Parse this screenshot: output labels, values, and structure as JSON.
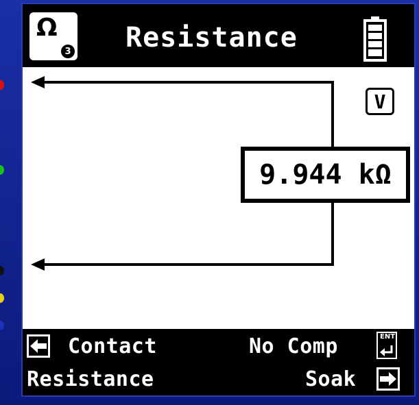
{
  "header": {
    "mode_symbol": "Ω",
    "mode_subscript": "3",
    "title": "Resistance",
    "battery_icon": "battery-full-icon"
  },
  "screen": {
    "volt_indicator": "V",
    "reading": "9.944 kΩ"
  },
  "softkeys": {
    "left_top": "Contact",
    "left_bottom": "Resistance",
    "right_top": "No Comp",
    "right_bottom": "Soak",
    "ent_label": "ENT"
  },
  "colors": {
    "frame": "#0b1e8c",
    "screen": "#ffffff",
    "device": "#000000"
  }
}
